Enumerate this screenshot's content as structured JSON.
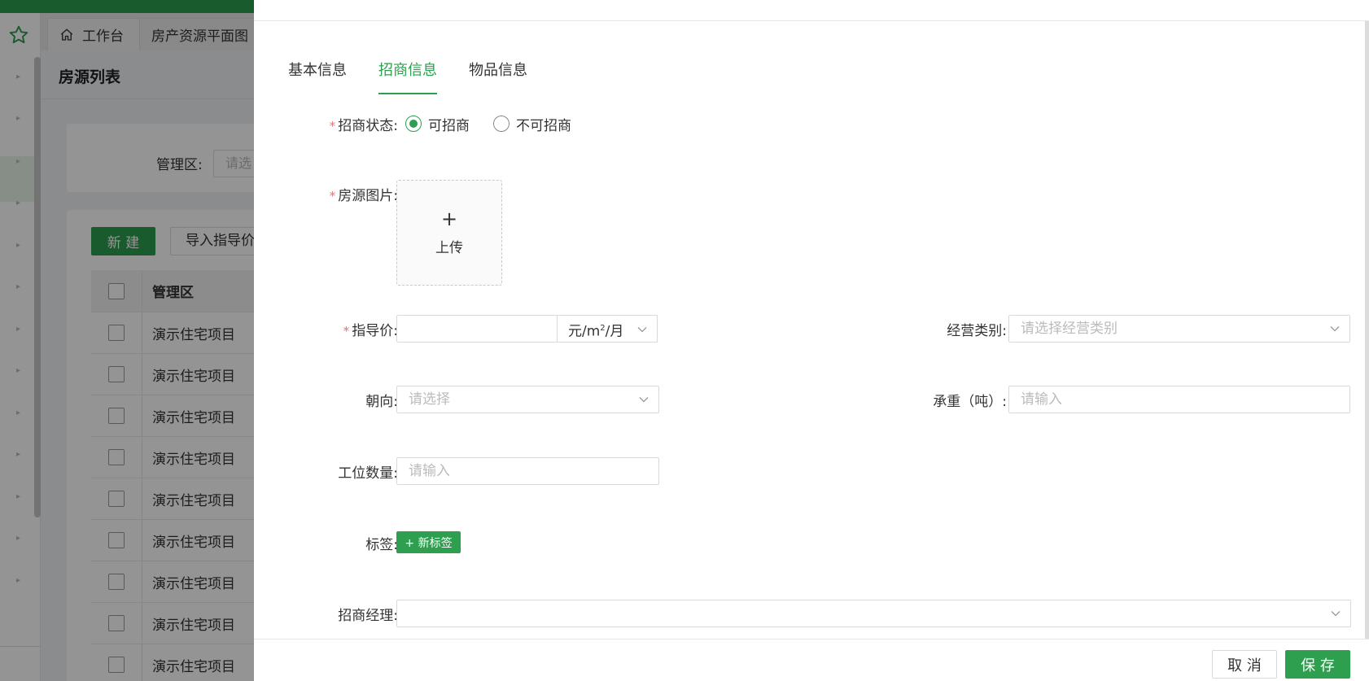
{
  "app": {
    "tabs": [
      {
        "label": "工作台",
        "icon": "home-icon"
      },
      {
        "label": "房产资源平面图"
      }
    ],
    "page_title": "房源列表",
    "filter": {
      "label": "管理区:",
      "placeholder": "请选"
    },
    "toolbar": {
      "new_label": "新 建",
      "import_label": "导入指导价"
    },
    "table": {
      "header": "管理区",
      "rows": [
        "演示住宅项目",
        "演示住宅项目",
        "演示住宅项目",
        "演示住宅项目",
        "演示住宅项目",
        "演示住宅项目",
        "演示住宅项目",
        "演示住宅项目",
        "演示住宅项目"
      ]
    }
  },
  "drawer": {
    "tabs": [
      {
        "label": "基本信息",
        "active": false
      },
      {
        "label": "招商信息",
        "active": true
      },
      {
        "label": "物品信息",
        "active": false
      }
    ],
    "form": {
      "status": {
        "label": "招商状态:",
        "required": true,
        "options": [
          "可招商",
          "不可招商"
        ],
        "selected": "可招商"
      },
      "images": {
        "label": "房源图片:",
        "required": true,
        "upload_plus": "+",
        "upload_label": "上传"
      },
      "guide_price": {
        "label": "指导价:",
        "required": true,
        "value": "",
        "unit_prefix": "元/m",
        "unit_sup": "2",
        "unit_suffix": "/月"
      },
      "business_type": {
        "label": "经营类别:",
        "placeholder": "请选择经营类别"
      },
      "orientation": {
        "label": "朝向:",
        "placeholder": "请选择"
      },
      "load": {
        "label": "承重（吨）:",
        "placeholder": "请输入"
      },
      "workstations": {
        "label": "工位数量:",
        "placeholder": "请输入"
      },
      "tags": {
        "label": "标签:",
        "button": "+ 新标签"
      },
      "manager": {
        "label": "招商经理:",
        "value": ""
      }
    },
    "footer": {
      "cancel": "取 消",
      "save": "保 存"
    }
  },
  "colors": {
    "primary": "#2e9e4f",
    "required": "#f56c6c",
    "overlay": "rgba(0,0,0,0.42)"
  }
}
